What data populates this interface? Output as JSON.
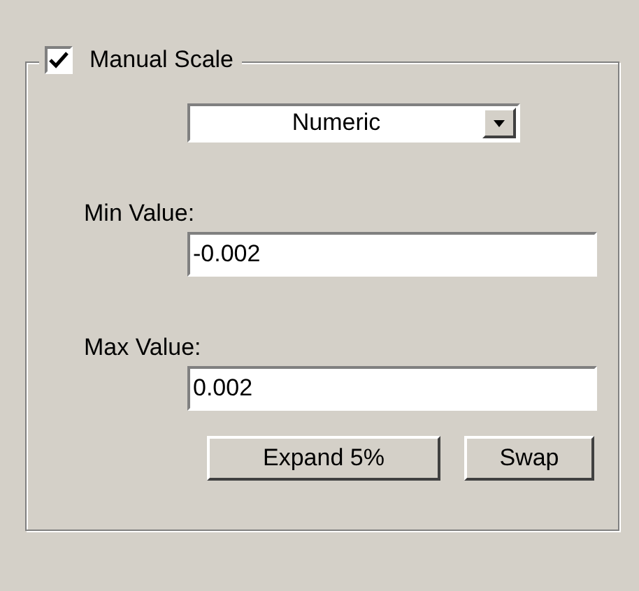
{
  "group": {
    "title": "Manual Scale",
    "checked": true
  },
  "dropdown": {
    "value": "Numeric"
  },
  "fields": [
    {
      "label": "Min Value:",
      "value": "-0.002"
    },
    {
      "label": "Max Value:",
      "value": "0.002"
    }
  ],
  "buttons": [
    "Expand 5%",
    "Swap"
  ]
}
